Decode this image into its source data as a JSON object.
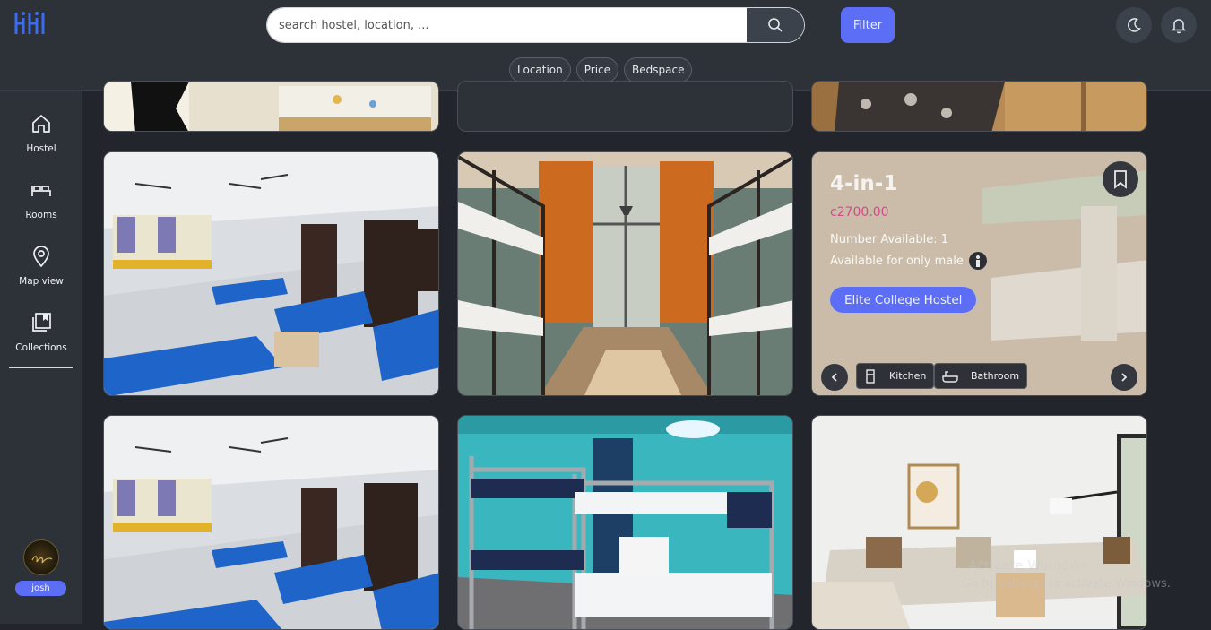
{
  "header": {
    "search_placeholder": "search hostel, location, ...",
    "filter_label": "Filter",
    "chips": [
      "Location",
      "Price",
      "Bedspace"
    ]
  },
  "sidebar": {
    "items": [
      {
        "label": "Hostel",
        "icon": "home-icon"
      },
      {
        "label": "Rooms",
        "icon": "bed-icon"
      },
      {
        "label": "Map view",
        "icon": "map-pin-icon"
      },
      {
        "label": "Collections",
        "icon": "collections-icon"
      }
    ],
    "active": "Collections",
    "user_name": "josh"
  },
  "featured_card": {
    "title": "4-in-1",
    "price": "c2700.00",
    "number_available": "Number Available: 1",
    "availability": "Available for only male",
    "hostel_name": "Elite College Hostel",
    "amenities": [
      "Kitchen",
      "Bathroom"
    ]
  },
  "watermark": {
    "line1": "Activate Windows",
    "line2": "Go to Settings to activate Windows."
  },
  "colors": {
    "accent": "#5b6ef5",
    "price": "#d24a8c",
    "background": "#22262c",
    "panel": "#2d3138"
  }
}
